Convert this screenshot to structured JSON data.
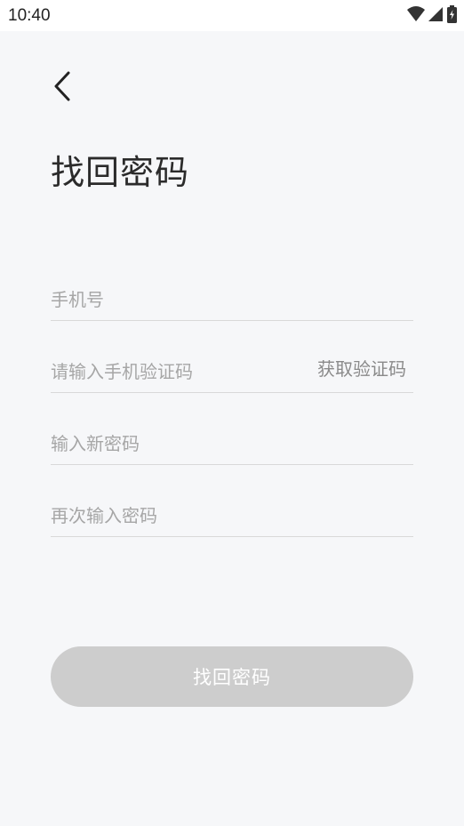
{
  "status_bar": {
    "time": "10:40",
    "icons": [
      "wifi-icon",
      "cellular-signal-icon",
      "battery-charging-icon"
    ]
  },
  "header": {
    "back_icon": "chevron-left-icon",
    "title": "找回密码"
  },
  "form": {
    "phone_placeholder": "手机号",
    "code_placeholder": "请输入手机验证码",
    "get_code_label": "获取验证码",
    "new_password_placeholder": "输入新密码",
    "confirm_password_placeholder": "再次输入密码"
  },
  "submit": {
    "label": "找回密码"
  }
}
